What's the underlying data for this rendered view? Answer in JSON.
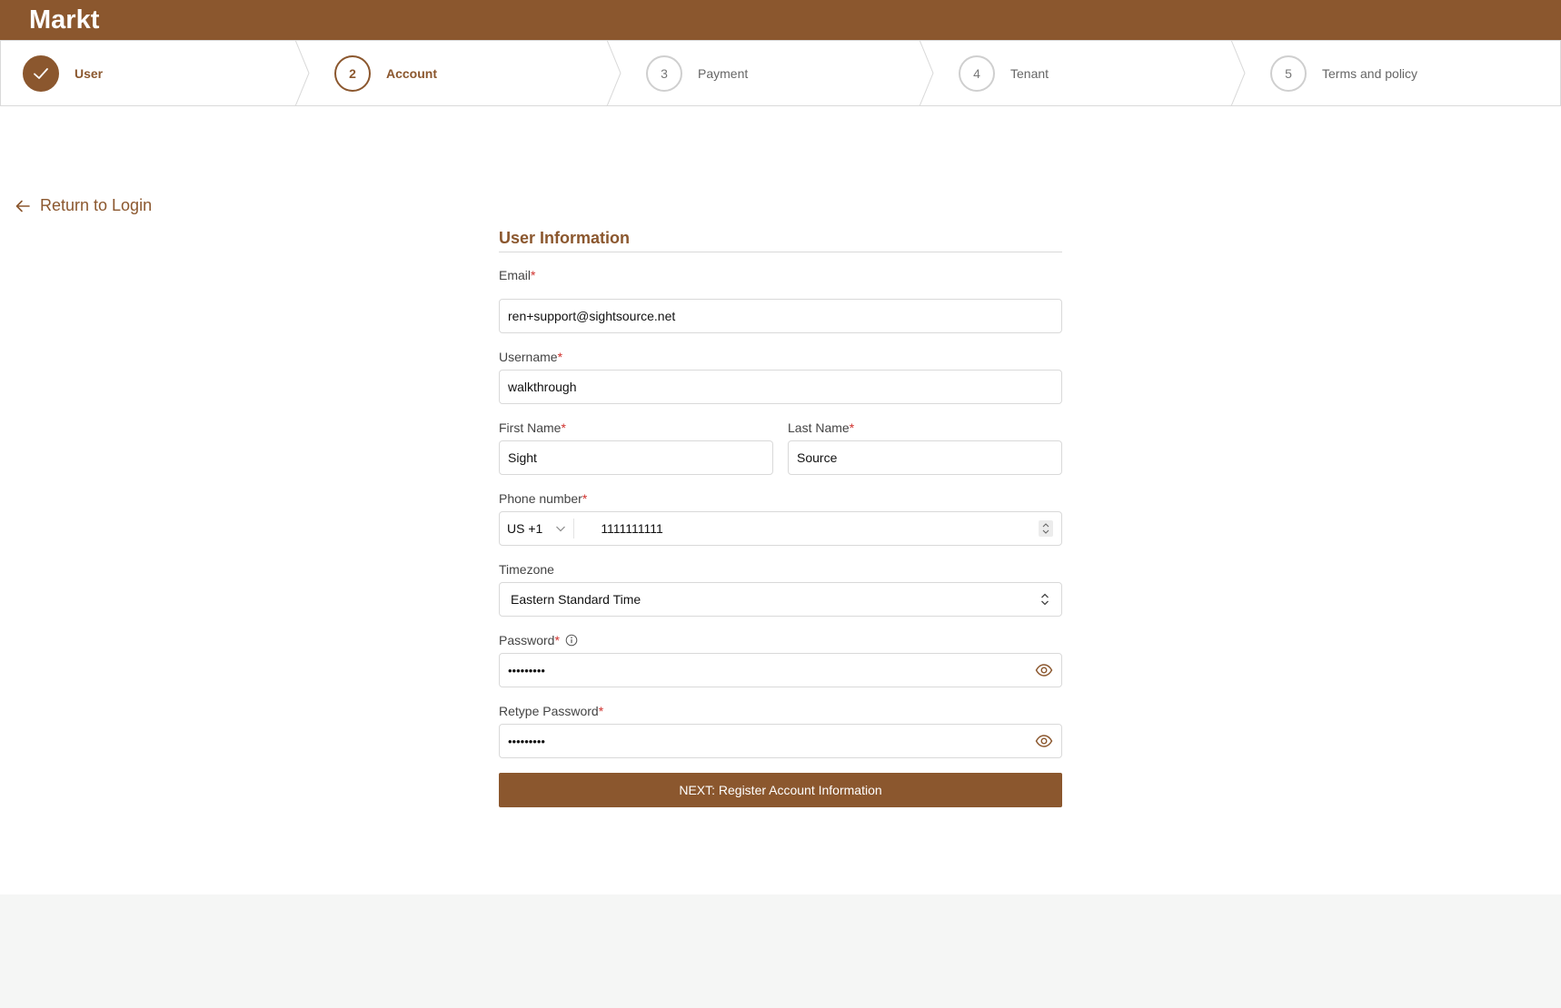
{
  "app": {
    "brand": "Markt"
  },
  "colors": {
    "primary": "#8b572e",
    "required": "#d0312d",
    "footer_bg": "#f5f6f5"
  },
  "steps": [
    {
      "number": "1",
      "label": "User",
      "state": "done",
      "icon": "check-icon"
    },
    {
      "number": "2",
      "label": "Account",
      "state": "active"
    },
    {
      "number": "3",
      "label": "Payment",
      "state": "pending"
    },
    {
      "number": "4",
      "label": "Tenant",
      "state": "pending"
    },
    {
      "number": "5",
      "label": "Terms and policy",
      "state": "pending"
    }
  ],
  "nav": {
    "return_label": "Return to Login",
    "return_icon": "arrow-left-icon"
  },
  "form": {
    "title": "User Information",
    "email": {
      "label": "Email",
      "required_mark": "*",
      "value": "ren+support@sightsource.net"
    },
    "username": {
      "label": "Username",
      "required_mark": "*",
      "value": "walkthrough"
    },
    "first_name": {
      "label": "First Name",
      "required_mark": "*",
      "value": "Sight"
    },
    "last_name": {
      "label": "Last Name",
      "required_mark": "*",
      "value": "Source"
    },
    "phone": {
      "label": "Phone number",
      "required_mark": "*",
      "country_code": "US +1",
      "value": "1111111111"
    },
    "timezone": {
      "label": "Timezone",
      "value": "Eastern Standard Time"
    },
    "password": {
      "label": "Password",
      "required_mark": "*",
      "value": "•••••••••",
      "info_icon": "info-icon",
      "toggle_icon": "eye-icon"
    },
    "retype_password": {
      "label": "Retype Password",
      "required_mark": "*",
      "value": "•••••••••",
      "toggle_icon": "eye-icon"
    },
    "submit_label": "NEXT: Register Account Information"
  }
}
